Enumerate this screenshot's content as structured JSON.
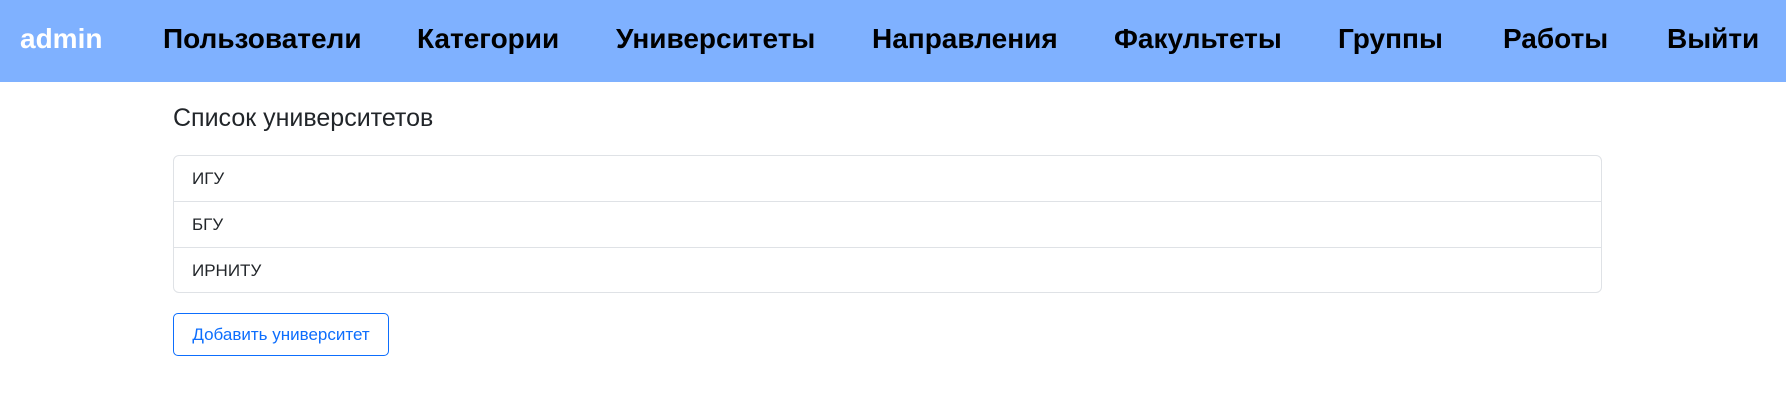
{
  "navbar": {
    "brand": "admin",
    "items": [
      {
        "label": "Пользователи"
      },
      {
        "label": "Категории"
      },
      {
        "label": "Университеты"
      },
      {
        "label": "Направления"
      },
      {
        "label": "Факультеты"
      },
      {
        "label": "Группы"
      },
      {
        "label": "Работы"
      },
      {
        "label": "Выйти"
      }
    ]
  },
  "main": {
    "title": "Список университетов",
    "universities": [
      {
        "name": "ИГУ"
      },
      {
        "name": "БГУ"
      },
      {
        "name": "ИРНИТУ"
      }
    ],
    "add_button_label": "Добавить университет"
  },
  "colors": {
    "navbar_bg": "#7fb1ff",
    "brand_text": "#ffffff",
    "nav_text": "#000000",
    "primary": "#0d6efd"
  }
}
